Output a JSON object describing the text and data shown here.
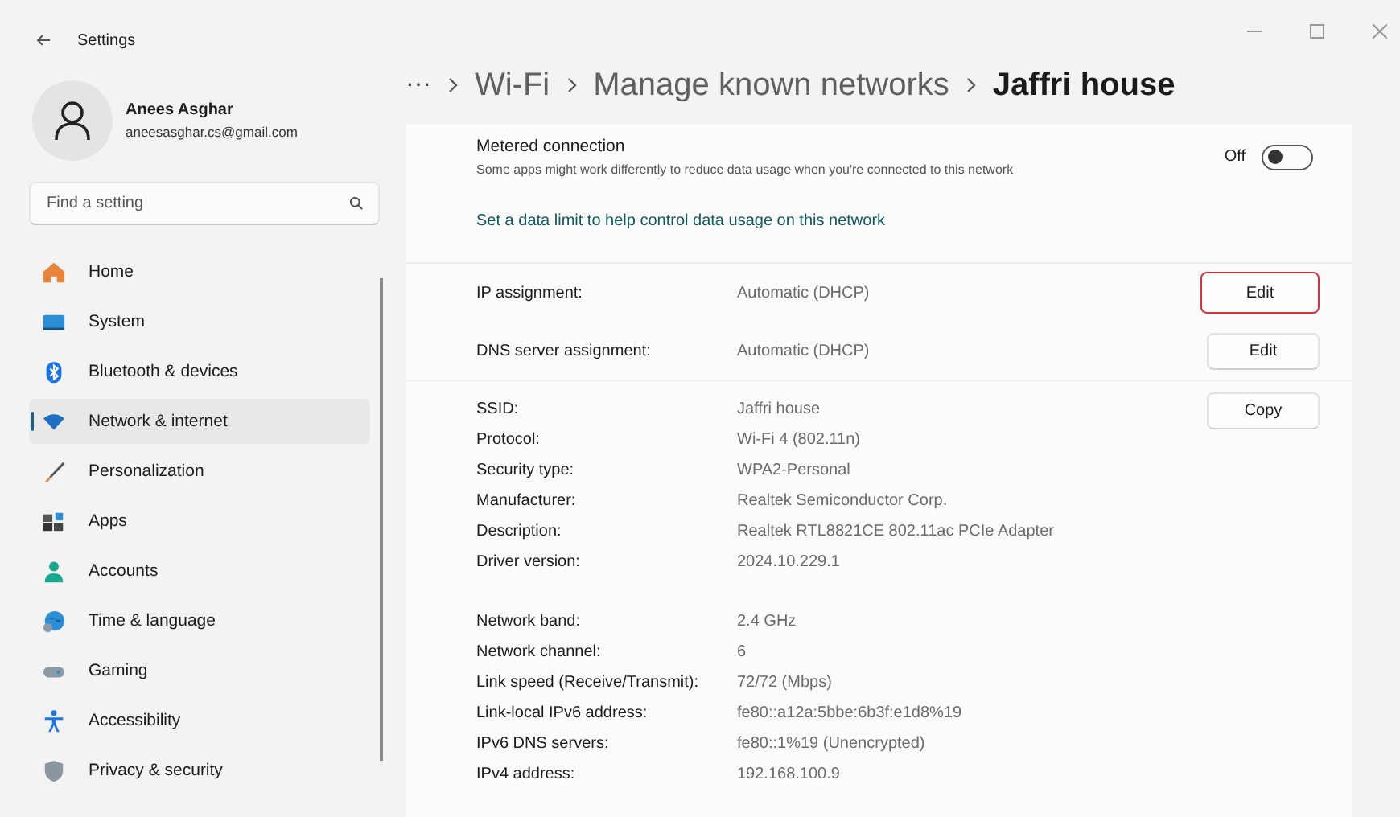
{
  "window": {
    "title": "Settings"
  },
  "account": {
    "name": "Anees Asghar",
    "email": "aneesasghar.cs@gmail.com"
  },
  "search": {
    "placeholder": "Find a setting"
  },
  "nav": [
    {
      "label": "Home",
      "selected": false
    },
    {
      "label": "System",
      "selected": false
    },
    {
      "label": "Bluetooth & devices",
      "selected": false
    },
    {
      "label": "Network & internet",
      "selected": true
    },
    {
      "label": "Personalization",
      "selected": false
    },
    {
      "label": "Apps",
      "selected": false
    },
    {
      "label": "Accounts",
      "selected": false
    },
    {
      "label": "Time & language",
      "selected": false
    },
    {
      "label": "Gaming",
      "selected": false
    },
    {
      "label": "Accessibility",
      "selected": false
    },
    {
      "label": "Privacy & security",
      "selected": false
    }
  ],
  "breadcrumb": [
    "···",
    "Wi-Fi",
    "Manage known networks",
    "Jaffri house"
  ],
  "metered": {
    "title": "Metered connection",
    "description": "Some apps might work differently to reduce data usage when you're connected to this network",
    "toggle_label": "Off",
    "on": false
  },
  "data_limit_link": "Set a data limit to help control data usage on this network",
  "assignments": [
    {
      "label": "IP assignment:",
      "value": "Automatic (DHCP)",
      "button": "Edit",
      "highlighted": true
    },
    {
      "label": "DNS server assignment:",
      "value": "Automatic (DHCP)",
      "button": "Edit",
      "highlighted": false
    }
  ],
  "properties": {
    "button": "Copy",
    "groups": [
      [
        {
          "label": "SSID:",
          "value": "Jaffri house"
        },
        {
          "label": "Protocol:",
          "value": "Wi-Fi 4 (802.11n)"
        },
        {
          "label": "Security type:",
          "value": "WPA2-Personal"
        },
        {
          "label": "Manufacturer:",
          "value": "Realtek Semiconductor Corp."
        },
        {
          "label": "Description:",
          "value": "Realtek RTL8821CE 802.11ac PCIe Adapter"
        },
        {
          "label": "Driver version:",
          "value": "2024.10.229.1"
        }
      ],
      [
        {
          "label": "Network band:",
          "value": "2.4 GHz"
        },
        {
          "label": "Network channel:",
          "value": "6"
        },
        {
          "label": "Link speed (Receive/Transmit):",
          "value": "72/72 (Mbps)"
        },
        {
          "label": "Link-local IPv6 address:",
          "value": "fe80::a12a:5bbe:6b3f:e1d8%19"
        },
        {
          "label": "IPv6 DNS servers:",
          "value": "fe80::1%19 (Unencrypted)"
        },
        {
          "label": "IPv4 address:",
          "value": "192.168.100.9"
        }
      ]
    ]
  }
}
